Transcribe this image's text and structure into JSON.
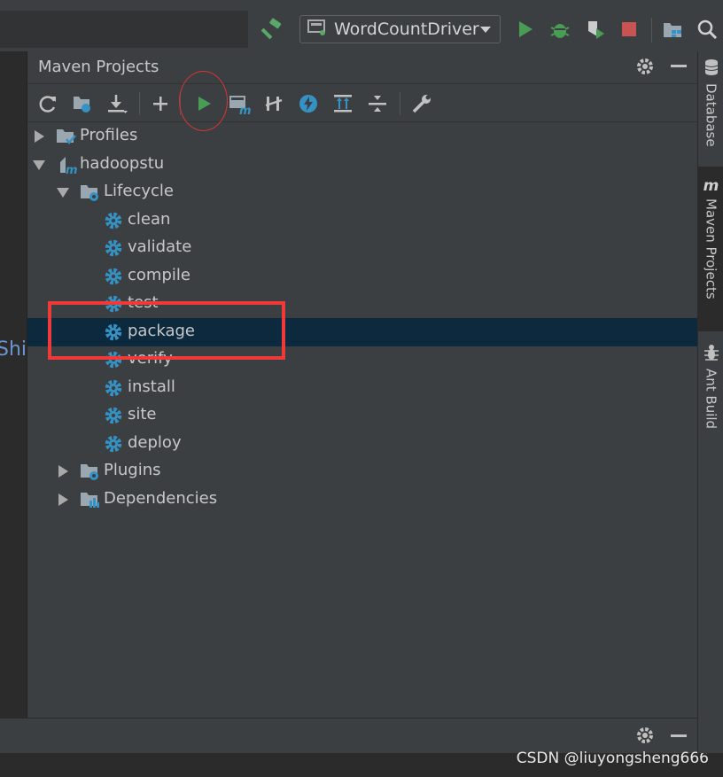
{
  "toolbar": {
    "run_config_label": "WordCountDriver",
    "icons": [
      "build-hammer-icon",
      "run-config-icon",
      "run-icon",
      "debug-icon",
      "coverage-icon",
      "stop-icon",
      "project-structure-icon",
      "search-icon"
    ]
  },
  "editor": {
    "visible_fragment": "Shi"
  },
  "maven": {
    "title": "Maven Projects",
    "toolbar_icons": [
      "reimport-icon",
      "generate-sources-icon",
      "download-icon",
      "add-icon",
      "run-maven-build-icon",
      "execute-goal-icon",
      "toggle-offline-icon",
      "skip-tests-icon",
      "show-dependencies-icon",
      "collapse-all-icon",
      "maven-settings-icon"
    ],
    "tree": {
      "profiles": "Profiles",
      "project": "hadoopstu",
      "lifecycle": "Lifecycle",
      "goals": [
        "clean",
        "validate",
        "compile",
        "test",
        "package",
        "verify",
        "install",
        "site",
        "deploy"
      ],
      "plugins": "Plugins",
      "dependencies": "Dependencies",
      "selected_goal": "package"
    }
  },
  "right_strip": {
    "tabs": [
      "Database",
      "Maven Projects",
      "Ant Build"
    ],
    "active_tab": "Maven Projects"
  },
  "watermark": "CSDN @liuyongsheng666",
  "colors": {
    "panel_bg": "#3c3f41",
    "editor_bg": "#2b2b2b",
    "selection_bg": "#0d293e",
    "gear_blue": "#3592c4",
    "run_green": "#4caf50",
    "stop_red": "#c75450",
    "annotation_red": "#f03a3a"
  }
}
